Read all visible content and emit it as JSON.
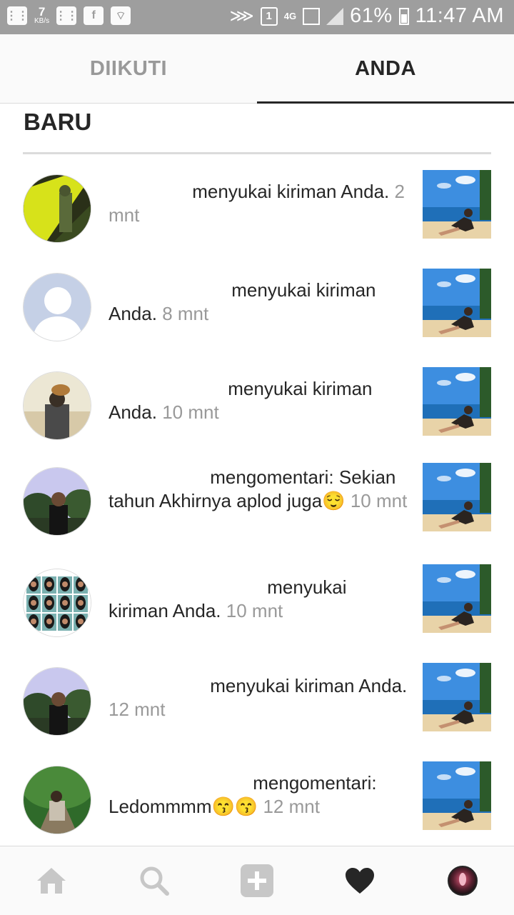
{
  "status_bar": {
    "speed_value": "7",
    "speed_unit": "KB/s",
    "sim_slot": "1",
    "network": "4G",
    "battery": "61%",
    "time": "11:47 AM"
  },
  "tabs": {
    "following_label": "DIIKUTI",
    "you_label": "ANDA",
    "active": "ANDA"
  },
  "section": {
    "title": "BARU"
  },
  "notifications": [
    {
      "text": "menyukai kiriman Anda.",
      "time": "2 mnt",
      "avatar": "yellow-black-photo"
    },
    {
      "text": "menyukai kiriman Anda.",
      "time": "8 mnt",
      "avatar": "default-avatar"
    },
    {
      "text": "menyukai kiriman Anda.",
      "time": "10 mnt",
      "avatar": "person-with-dog"
    },
    {
      "text": "mengomentari: Sekian tahun Akhirnya aplod juga😌",
      "time": "10 mnt",
      "avatar": "person-in-park"
    },
    {
      "text": "menyukai kiriman Anda.",
      "time": "10 mnt",
      "avatar": "photo-grid"
    },
    {
      "text": "menyukai kiriman Anda.",
      "time": "12 mnt",
      "avatar": "person-in-park"
    },
    {
      "text": "mengomentari: Ledommmm😙😙",
      "time": "12 mnt",
      "avatar": "person-on-bridge"
    }
  ],
  "bottom_nav": [
    "home-icon",
    "search-icon",
    "add-icon",
    "heart-icon",
    "profile-avatar"
  ],
  "colors": {
    "status_bar": "#9e9e9e",
    "text_primary": "#262626",
    "text_muted": "#999999",
    "divider": "#dbdbdb",
    "sky": "#3d8ee0",
    "sea": "#1f6fb8",
    "sand": "#e8d3a8"
  }
}
